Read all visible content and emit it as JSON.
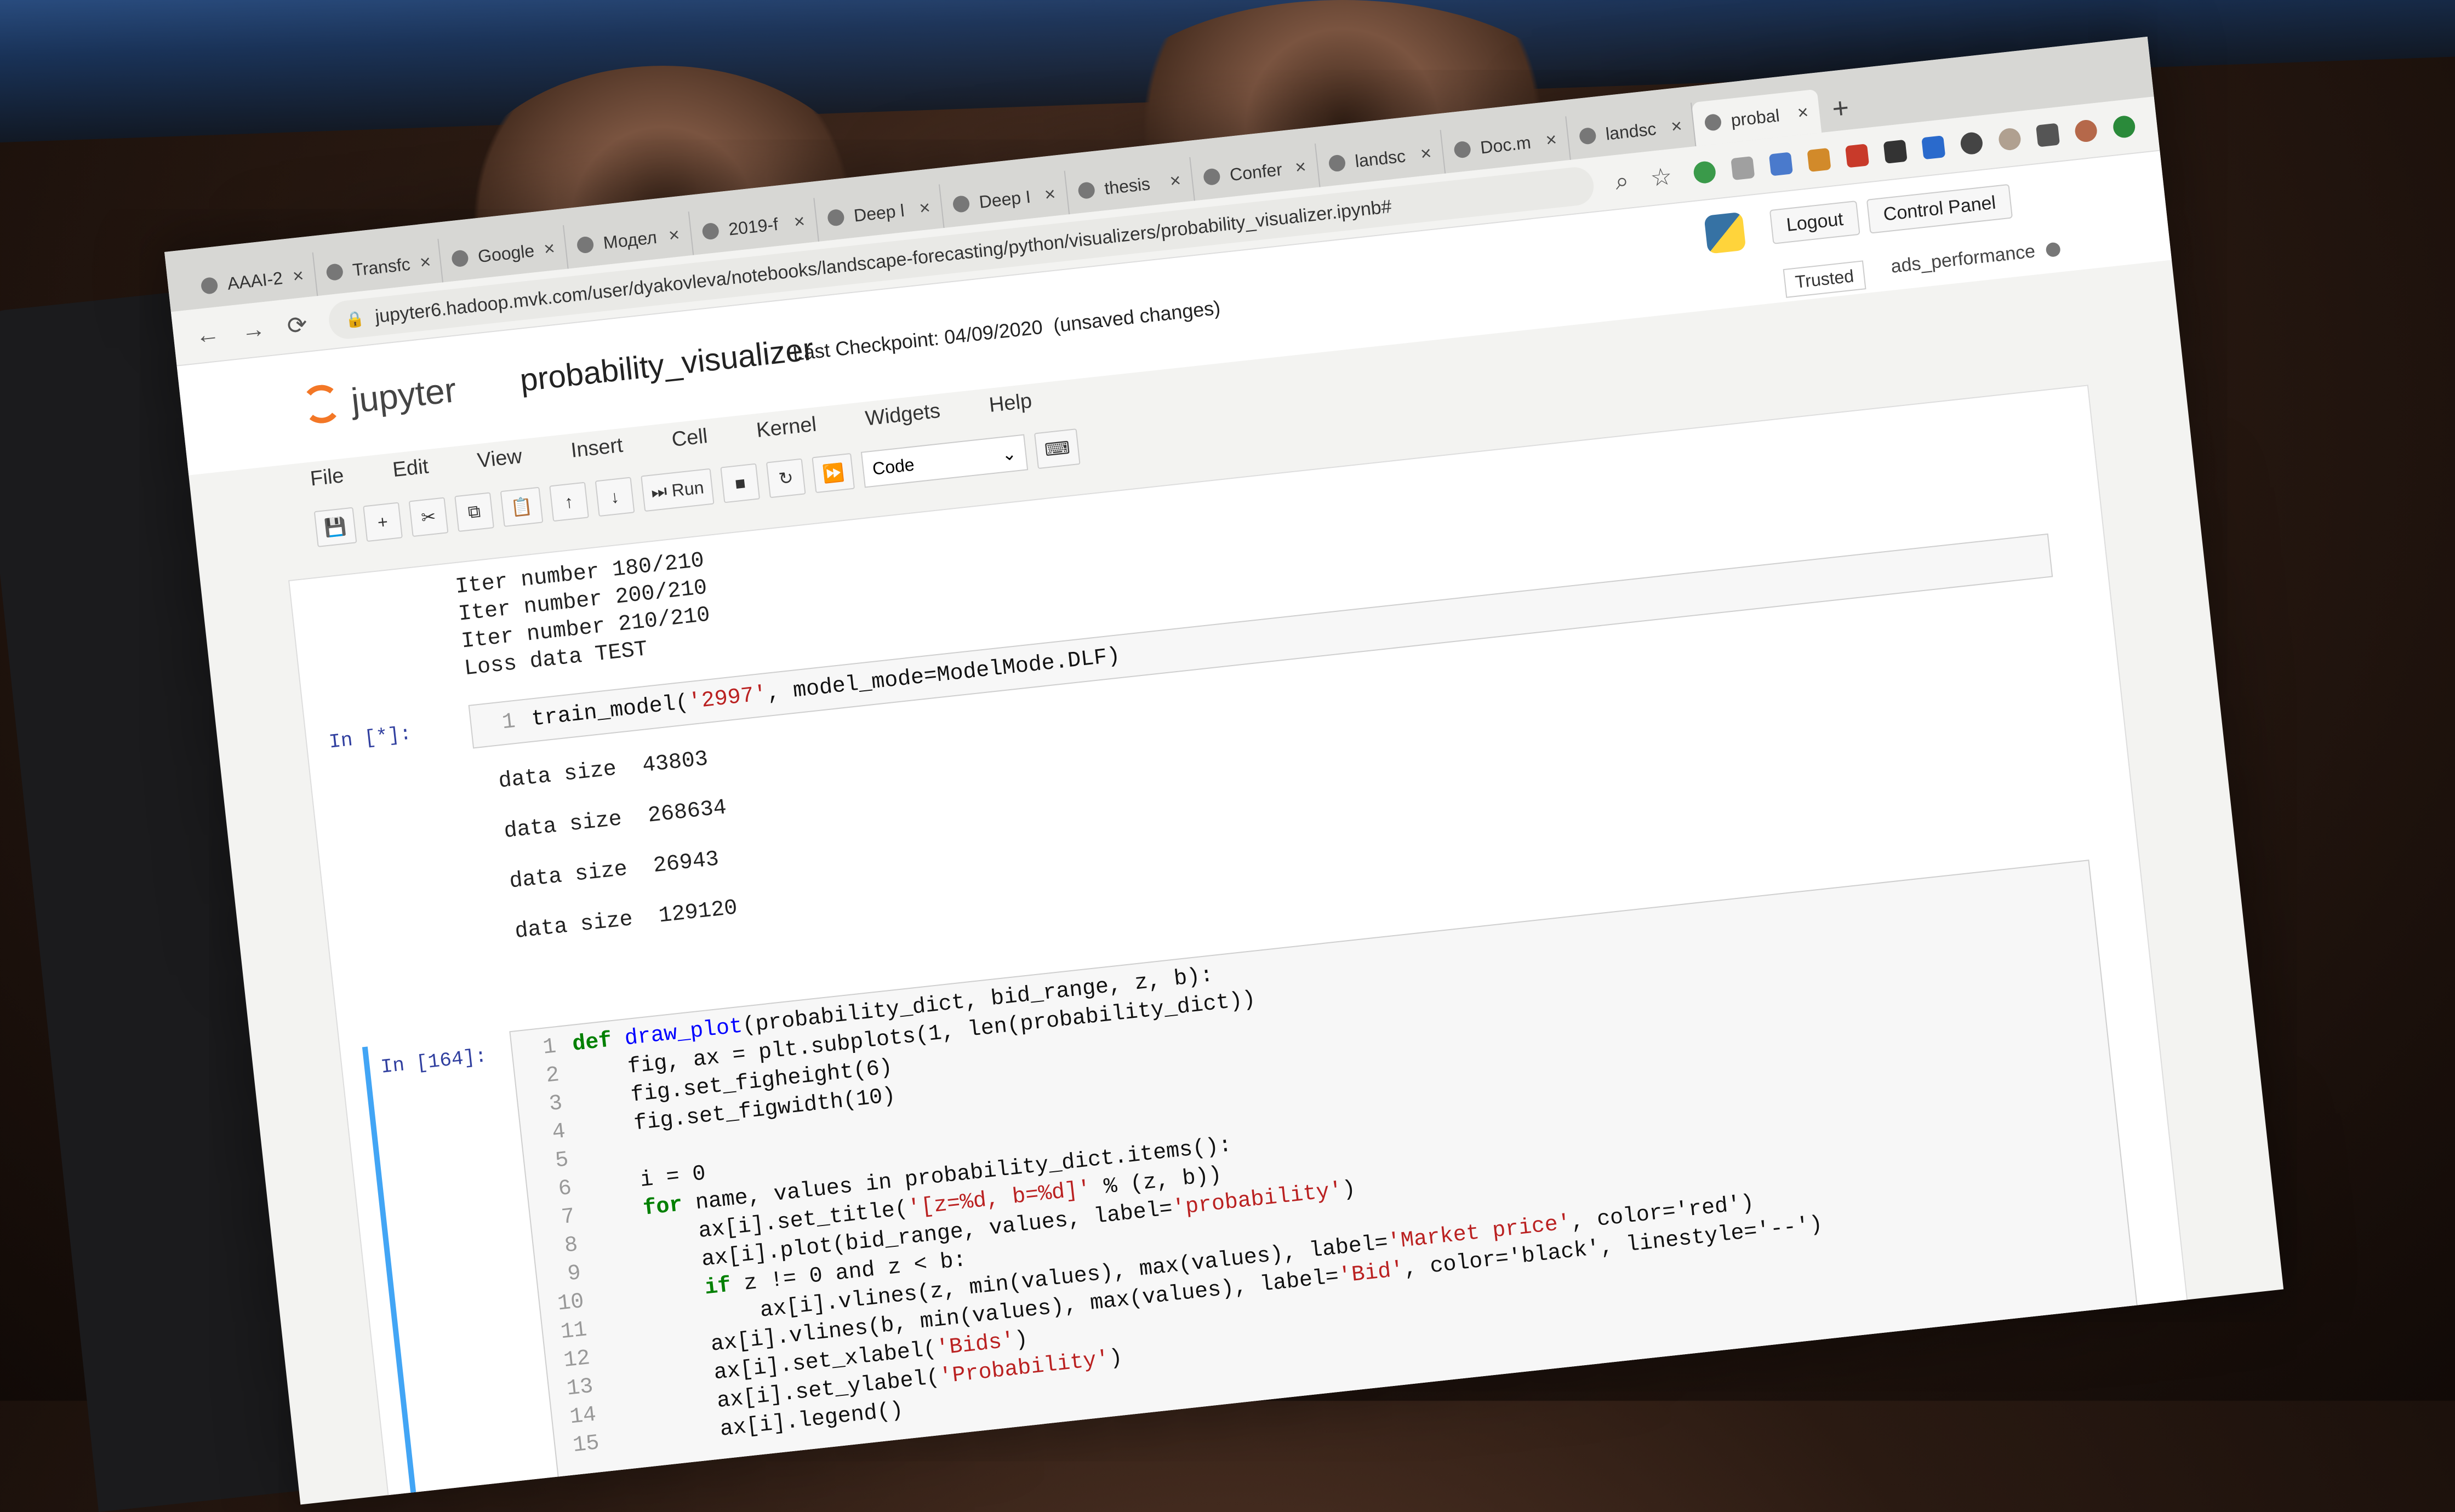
{
  "browser": {
    "tabs": [
      {
        "label": "AAAI-2"
      },
      {
        "label": "Transfc"
      },
      {
        "label": "Google"
      },
      {
        "label": "Модел"
      },
      {
        "label": "2019-f"
      },
      {
        "label": "Deep l"
      },
      {
        "label": "Deep I"
      },
      {
        "label": "thesis"
      },
      {
        "label": "Confer"
      },
      {
        "label": "landsc"
      },
      {
        "label": "Doc.m"
      },
      {
        "label": "landsc"
      },
      {
        "label": "probal"
      }
    ],
    "new_tab": "+",
    "url": "jupyter6.hadoop.mvk.com/user/dyakovleva/notebooks/landscape-forecasting/python/visualizers/probability_visualizer.ipynb#"
  },
  "jupyter": {
    "logo_text": "jupyter",
    "notebook_name": "probability_visualizer",
    "checkpoint": "Last Checkpoint: 04/09/2020",
    "unsaved": "(unsaved changes)",
    "logout": "Logout",
    "control_panel": "Control Panel",
    "trusted": "Trusted",
    "kernel_name": "ads_performance",
    "menu": [
      "File",
      "Edit",
      "View",
      "Insert",
      "Cell",
      "Kernel",
      "Widgets",
      "Help"
    ],
    "run_label": "Run",
    "cell_type": "Code"
  },
  "notebook": {
    "prev_output": [
      "Iter number 180/210",
      "Iter number 200/210",
      "Iter number 210/210",
      "Loss data TEST"
    ],
    "cell1": {
      "prompt": "In [*]:",
      "line_no": "1",
      "code_a": "train_model(",
      "code_str": "'2997'",
      "code_b": ", model_mode=ModelMode.DLF)",
      "outputs": [
        "data size  43803",
        "data size  268634",
        "data size  26943",
        "data size  129120"
      ]
    },
    "cell2": {
      "prompt": "In [164]:",
      "lines": [
        {
          "n": "1",
          "kw": "def ",
          "fn": "draw_plot",
          "rest": "(probability_dict, bid_range, z, b):",
          "str": "",
          "tail": ""
        },
        {
          "n": "2",
          "kw": "",
          "fn": "",
          "rest": "    fig, ax = plt.subplots(1, len(probability_dict))",
          "str": "",
          "tail": ""
        },
        {
          "n": "3",
          "kw": "",
          "fn": "",
          "rest": "    fig.set_figheight(6)",
          "str": "",
          "tail": ""
        },
        {
          "n": "4",
          "kw": "",
          "fn": "",
          "rest": "    fig.set_figwidth(10)",
          "str": "",
          "tail": ""
        },
        {
          "n": "5",
          "kw": "",
          "fn": "",
          "rest": "",
          "str": "",
          "tail": ""
        },
        {
          "n": "6",
          "kw": "",
          "fn": "",
          "rest": "    i = 0",
          "str": "",
          "tail": ""
        },
        {
          "n": "7",
          "kw": "    for ",
          "fn": "",
          "rest": "name, values in probability_dict.items():",
          "str": "",
          "tail": ""
        },
        {
          "n": "8",
          "kw": "",
          "fn": "",
          "rest": "        ax[i].set_title(",
          "str": "'[z=%d, b=%d]'",
          "tail": " % (z, b))"
        },
        {
          "n": "9",
          "kw": "",
          "fn": "",
          "rest": "        ax[i].plot(bid_range, values, label=",
          "str": "'probability'",
          "tail": ")"
        },
        {
          "n": "10",
          "kw": "        if ",
          "fn": "",
          "rest": "z != 0 and z < b:",
          "str": "",
          "tail": ""
        },
        {
          "n": "11",
          "kw": "",
          "fn": "",
          "rest": "            ax[i].vlines(z, min(values), max(values), label=",
          "str": "'Market price'",
          "tail": ", color='red')"
        },
        {
          "n": "12",
          "kw": "",
          "fn": "",
          "rest": "        ax[i].vlines(b, min(values), max(values), label=",
          "str": "'Bid'",
          "tail": ", color='black', linestyle='--')"
        },
        {
          "n": "13",
          "kw": "",
          "fn": "",
          "rest": "        ax[i].set_xlabel(",
          "str": "'Bids'",
          "tail": ")"
        },
        {
          "n": "14",
          "kw": "",
          "fn": "",
          "rest": "        ax[i].set_ylabel(",
          "str": "'Probability'",
          "tail": ")"
        },
        {
          "n": "15",
          "kw": "",
          "fn": "",
          "rest": "        ax[i].legend()",
          "str": "",
          "tail": ""
        }
      ]
    }
  }
}
